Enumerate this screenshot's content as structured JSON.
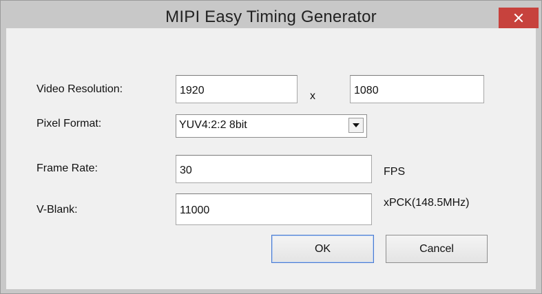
{
  "window": {
    "title": "MIPI Easy Timing Generator",
    "close_symbol": "×"
  },
  "form": {
    "video_resolution": {
      "label": "Video Resolution:",
      "width_value": "1920",
      "separator": "x",
      "height_value": "1080"
    },
    "pixel_format": {
      "label": "Pixel Format:",
      "selected": "YUV4:2:2 8bit"
    },
    "frame_rate": {
      "label": "Frame Rate:",
      "value": "30",
      "unit": "FPS"
    },
    "v_blank": {
      "label": "V-Blank:",
      "value": "11000",
      "unit": "xPCK(148.5MHz)"
    }
  },
  "buttons": {
    "ok_label": "OK",
    "cancel_label": "Cancel"
  },
  "colors": {
    "titlebar": "#c8c8c8",
    "client_background": "#f0f0f0",
    "close_button": "#c7423d",
    "default_button_border": "#4a7ad0"
  },
  "icons": {
    "close": "close-icon",
    "dropdown": "chevron-down-icon"
  }
}
